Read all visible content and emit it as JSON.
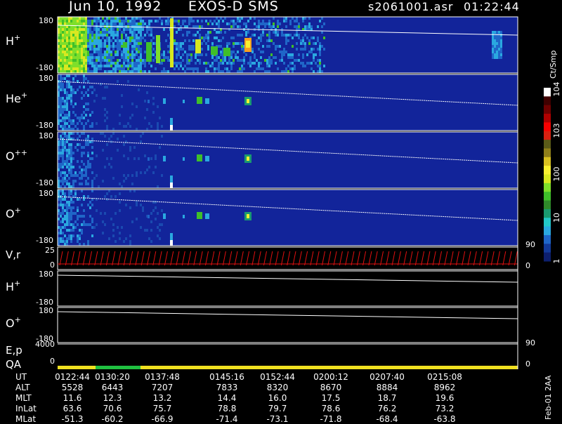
{
  "header": {
    "date": "Jun 10, 1992",
    "instrument": "EXOS-D SMS",
    "file": "s2061001.asr",
    "time": "01:22:44"
  },
  "colorbar": {
    "title": "Ct/Smp",
    "ticks": [
      "1",
      "10",
      "100",
      "10^3",
      "10^4"
    ],
    "colors": [
      "#0d1f6e",
      "#123a9a",
      "#1f66c8",
      "#2aa8e0",
      "#22c8c8",
      "#1a9a70",
      "#2f8a2a",
      "#3fbf2a",
      "#7fdf2a",
      "#d8e820",
      "#f8f030",
      "#d8c020",
      "#8f7f1a",
      "#5a5a18",
      "#d82010",
      "#f80000",
      "#b00000",
      "#700000",
      "#400000",
      "#ffffff"
    ]
  },
  "panels": [
    {
      "id": "h_plus",
      "species": "H",
      "charge": "+",
      "ymax": "180",
      "ymin": "-180"
    },
    {
      "id": "he_plus",
      "species": "He",
      "charge": "+",
      "ymax": "180",
      "ymin": "-180"
    },
    {
      "id": "o_pp",
      "species": "O",
      "charge": "++",
      "ymax": "180",
      "ymin": "-180"
    },
    {
      "id": "o_plus",
      "species": "O",
      "charge": "+",
      "ymax": "180",
      "ymin": "-180"
    }
  ],
  "vr_panel": {
    "label": "V,r",
    "ymax": "25",
    "y0": "0",
    "right_top": "90",
    "right_zero": "0"
  },
  "lines_panels": [
    {
      "species": "H",
      "charge": "+",
      "ymax": "180",
      "ymin": "-180"
    },
    {
      "species": "O",
      "charge": "+",
      "ymax": "180",
      "ymin": "-180"
    }
  ],
  "ep_panel": {
    "label": "E,p",
    "ymax": "4000",
    "right_top": "90"
  },
  "qa_panel": {
    "label": "QA",
    "y0": "0",
    "right_zero": "0"
  },
  "chart_data": {
    "type": "heatmap",
    "title": "",
    "x_ticks": [
      "0122:44",
      "0130:20",
      "0137:48",
      "0145:16",
      "0152:44",
      "0200:12",
      "0207:40",
      "0215:08"
    ],
    "footer_rows": [
      {
        "name": "UT",
        "values": [
          "0122:44",
          "0130:20",
          "0137:48",
          "0145:16",
          "0152:44",
          "0200:12",
          "0207:40",
          "0215:08"
        ]
      },
      {
        "name": "ALT",
        "values": [
          "5528",
          "6443",
          "7207",
          "7833",
          "8320",
          "8670",
          "8884",
          "8962"
        ]
      },
      {
        "name": "MLT",
        "values": [
          "11.6",
          "12.3",
          "13.2",
          "14.4",
          "16.0",
          "17.5",
          "18.7",
          "19.6"
        ]
      },
      {
        "name": "InLat",
        "values": [
          "63.6",
          "70.6",
          "75.7",
          "78.8",
          "79.7",
          "78.6",
          "76.2",
          "73.2"
        ]
      },
      {
        "name": "MLat",
        "values": [
          "-51.3",
          "-60.2",
          "-66.9",
          "-71.4",
          "-73.1",
          "-71.8",
          "-68.4",
          "-63.8"
        ]
      }
    ]
  },
  "stamp": "Feb-01 2AA"
}
